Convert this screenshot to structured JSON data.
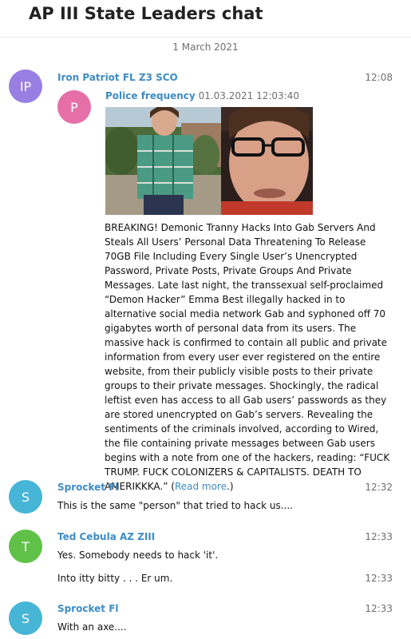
{
  "chat": {
    "title": "AP III State Leaders chat"
  },
  "date_separator": "1 March 2021",
  "messages": [
    {
      "sender": "Iron Patriot FL Z3 SCO",
      "initials": "IP",
      "avatar_color": "#9a7fe2",
      "time": "12:08",
      "forwarded": {
        "initials": "P",
        "avatar_color": "#e66fa8",
        "from": "Police frequency",
        "date": "01.03.2021 12:03:40",
        "text": "BREAKING! Demonic Tranny Hacks Into Gab Servers And Steals All Users’ Personal Data Threatening To Release 70GB File Including Every Single User’s Unencrypted Password, Private Posts, Private Groups And Private Messages. Late last night, the transsexual self-proclaimed “Demon Hacker” Emma Best illegally hacked in to alternative social media network Gab and syphoned off 70 gigabytes worth of personal data from its users. The massive hack is confirmed to contain all public and private information from every user ever registered on the entire website, from their publicly visible posts to their private groups to their private messages. Shockingly, the radical leftist even has access to all Gab users’ passwords as they are stored unencrypted on Gab’s servers. Revealing the sentiments of the criminals involved, according to Wired, the file containing private messages between Gab users begins with a note from one of the hackers, reading: “FUCK TRUMP. FUCK COLONIZERS & CAPITALISTS. DEATH TO AMERIKKKA.” (",
        "read_more": "Read more",
        "text_end": ".)"
      }
    },
    {
      "sender": "Sprocket Fl",
      "initials": "S",
      "avatar_color": "#46b5d6",
      "time": "12:32",
      "text": "This is the same \"person\" that tried to hack us...."
    },
    {
      "sender": "Ted Cebula AZ ZIII",
      "initials": "T",
      "avatar_color": "#5fc148",
      "time": "12:33",
      "text": "Yes. Somebody needs to hack 'it'."
    },
    {
      "time": "12:33",
      "text": "Into itty bitty . . . Er um."
    },
    {
      "sender": "Sprocket Fl",
      "initials": "S",
      "avatar_color": "#46b5d6",
      "time": "12:33",
      "text": "With an axe...."
    }
  ]
}
